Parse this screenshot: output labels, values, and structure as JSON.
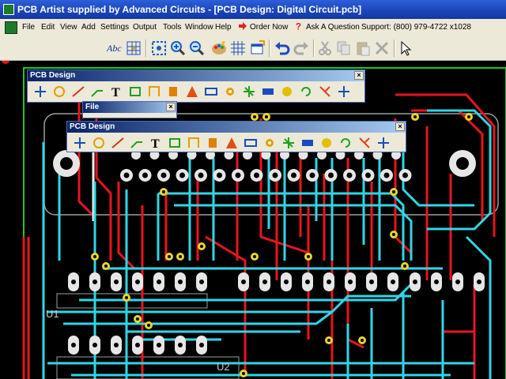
{
  "window": {
    "title": "PCB Artist supplied by Advanced Circuits - [PCB Design: Digital Circuit.pcb]"
  },
  "menubar": {
    "items": [
      {
        "label": "File",
        "underline": "F"
      },
      {
        "label": "Edit",
        "underline": "E"
      },
      {
        "label": "View",
        "underline": "V"
      },
      {
        "label": "Add",
        "underline": "A"
      },
      {
        "label": "Settings",
        "underline": "S"
      },
      {
        "label": "Output",
        "underline": "O"
      },
      {
        "label": "Tools",
        "underline": "T"
      },
      {
        "label": "Window",
        "underline": "W"
      },
      {
        "label": "Help",
        "underline": "H"
      }
    ],
    "order_now": "Order Now",
    "ask_question": "Ask A Question",
    "support": "Support: (800) 979-4722 x1028"
  },
  "toolbar": {
    "icons": [
      "text-style-icon",
      "grid-icon",
      "zoom-fit-icon",
      "zoom-in-icon",
      "zoom-out-icon",
      "colors-icon",
      "layers-grid-icon",
      "window-icon",
      "undo-icon",
      "redo-icon",
      "cut-icon",
      "copy-icon",
      "paste-icon",
      "delete-icon",
      "pointer-icon"
    ]
  },
  "panels": {
    "pcb_design_back": {
      "title": "PCB Design",
      "close": "×"
    },
    "file": {
      "title": "File",
      "close": "×"
    },
    "pcb_design_front": {
      "title": "PCB Design",
      "close": "×"
    }
  },
  "board": {
    "refdes_u1": "U1",
    "refdes_u2": "U2"
  },
  "colors": {
    "trace_red": "#e8141e",
    "trace_cyan": "#2fd6e6",
    "pad": "#e6e6e6",
    "via": "#e8d62a",
    "outline": "#9aa0a0"
  }
}
